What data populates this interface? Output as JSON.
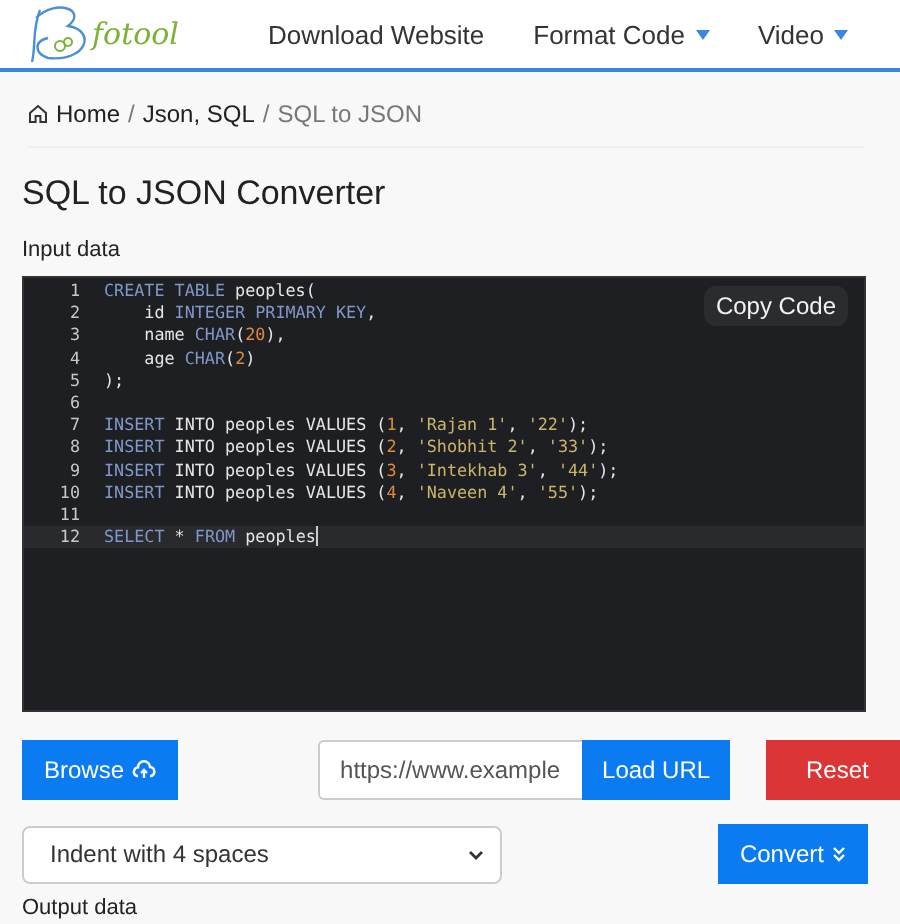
{
  "header": {
    "logo_text": "fotool",
    "nav": [
      {
        "label": "Download Website",
        "dropdown": false
      },
      {
        "label": "Format Code",
        "dropdown": true
      },
      {
        "label": "Video",
        "dropdown": true
      }
    ]
  },
  "breadcrumb": [
    {
      "label": "Home",
      "kind": "home"
    },
    {
      "separator": "/",
      "label": "Json, SQL",
      "kind": "link"
    },
    {
      "separator": "/",
      "label": "SQL to JSON",
      "kind": "current"
    }
  ],
  "title": "SQL to JSON Converter",
  "input_label": "Input data",
  "editor": {
    "copy_button": "Copy Code",
    "lines": [
      {
        "number": "1",
        "active": false,
        "tokens": [
          {
            "text": "CREATE TABLE",
            "kind": "keyword"
          },
          {
            "text": " peoples(",
            "kind": "plain"
          }
        ]
      },
      {
        "number": "2",
        "active": false,
        "tokens": [
          {
            "text": "    id ",
            "kind": "plain"
          },
          {
            "text": "INTEGER PRIMARY KEY",
            "kind": "keyword"
          },
          {
            "text": ",",
            "kind": "plain"
          }
        ]
      },
      {
        "number": "3",
        "active": false,
        "tokens": [
          {
            "text": "    name ",
            "kind": "plain"
          },
          {
            "text": "CHAR",
            "kind": "keyword"
          },
          {
            "text": "(",
            "kind": "plain"
          },
          {
            "text": "20",
            "kind": "number"
          },
          {
            "text": "),",
            "kind": "plain"
          }
        ]
      },
      {
        "number": "4",
        "active": false,
        "tokens": [
          {
            "text": "    age ",
            "kind": "plain"
          },
          {
            "text": "CHAR",
            "kind": "keyword"
          },
          {
            "text": "(",
            "kind": "plain"
          },
          {
            "text": "2",
            "kind": "number"
          },
          {
            "text": ")",
            "kind": "plain"
          }
        ]
      },
      {
        "number": "5",
        "active": false,
        "tokens": [
          {
            "text": ");",
            "kind": "plain"
          }
        ]
      },
      {
        "number": "6",
        "active": false
      },
      {
        "number": "7",
        "active": false,
        "tokens": [
          {
            "text": "INSERT",
            "kind": "keyword"
          },
          {
            "text": " INTO peoples VALUES (",
            "kind": "plain"
          },
          {
            "text": "1",
            "kind": "number"
          },
          {
            "text": ", ",
            "kind": "plain"
          },
          {
            "text": "'Rajan 1'",
            "kind": "string"
          },
          {
            "text": ", ",
            "kind": "plain"
          },
          {
            "text": "'22'",
            "kind": "string"
          },
          {
            "text": ");",
            "kind": "plain"
          }
        ]
      },
      {
        "number": "8",
        "active": false,
        "tokens": [
          {
            "text": "INSERT",
            "kind": "keyword"
          },
          {
            "text": " INTO peoples VALUES (",
            "kind": "plain"
          },
          {
            "text": "2",
            "kind": "number"
          },
          {
            "text": ", ",
            "kind": "plain"
          },
          {
            "text": "'Shobhit 2'",
            "kind": "string"
          },
          {
            "text": ", ",
            "kind": "plain"
          },
          {
            "text": "'33'",
            "kind": "string"
          },
          {
            "text": ");",
            "kind": "plain"
          }
        ]
      },
      {
        "number": "9",
        "active": false,
        "tokens": [
          {
            "text": "INSERT",
            "kind": "keyword"
          },
          {
            "text": " INTO peoples VALUES (",
            "kind": "plain"
          },
          {
            "text": "3",
            "kind": "number"
          },
          {
            "text": ", ",
            "kind": "plain"
          },
          {
            "text": "'Intekhab 3'",
            "kind": "string"
          },
          {
            "text": ", ",
            "kind": "plain"
          },
          {
            "text": "'44'",
            "kind": "string"
          },
          {
            "text": ");",
            "kind": "plain"
          }
        ]
      },
      {
        "number": "10",
        "active": false,
        "tokens": [
          {
            "text": "INSERT",
            "kind": "keyword"
          },
          {
            "text": " INTO peoples VALUES (",
            "kind": "plain"
          },
          {
            "text": "4",
            "kind": "number"
          },
          {
            "text": ", ",
            "kind": "plain"
          },
          {
            "text": "'Naveen 4'",
            "kind": "string"
          },
          {
            "text": ", ",
            "kind": "plain"
          },
          {
            "text": "'55'",
            "kind": "string"
          },
          {
            "text": ");",
            "kind": "plain"
          }
        ]
      },
      {
        "number": "11",
        "active": false
      },
      {
        "number": "12",
        "active": true,
        "tokens": [
          {
            "text": "SELECT",
            "kind": "keyword"
          },
          {
            "text": " * ",
            "kind": "plain"
          },
          {
            "text": "FROM",
            "kind": "keyword"
          },
          {
            "text": " peoples",
            "kind": "plain"
          }
        ]
      }
    ]
  },
  "browse_button": "Browse",
  "url_field": {
    "placeholder": "https://www.example"
  },
  "load_button": "Load URL",
  "reset_button": "Reset",
  "indent_select": {
    "value": "Indent with 4 spaces"
  },
  "convert_button": "Convert",
  "output_label": "Output data"
}
